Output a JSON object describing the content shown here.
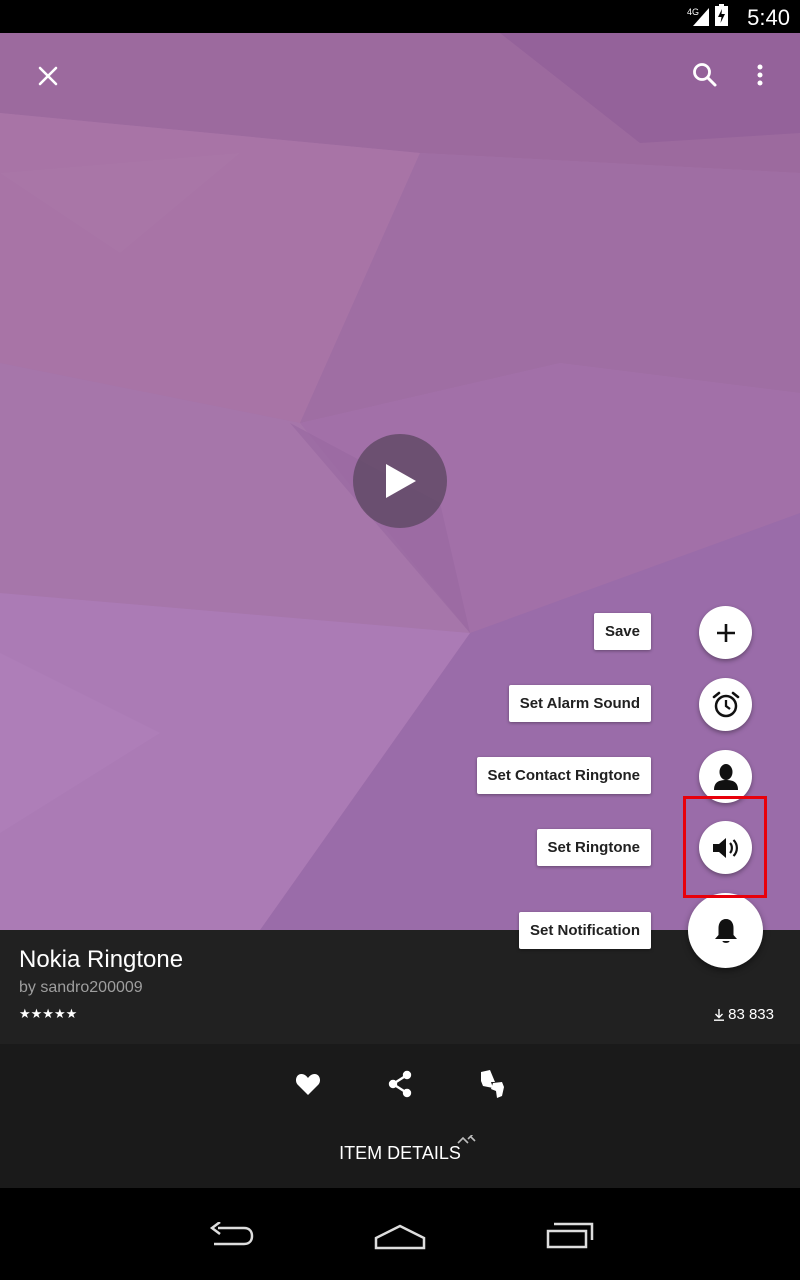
{
  "status": {
    "time": "5:40",
    "network": "4G"
  },
  "ringtone": {
    "title": "Nokia Ringtone",
    "author": "by sandro200009",
    "rating": "★★★★★",
    "rating_value": 5,
    "downloads": "83 833"
  },
  "fab_menu": {
    "items": [
      {
        "label": "Save",
        "icon": "plus-icon"
      },
      {
        "label": "Set Alarm Sound",
        "icon": "alarm-clock-icon"
      },
      {
        "label": "Set Contact Ringtone",
        "icon": "contact-person-icon"
      },
      {
        "label": "Set Ringtone",
        "icon": "speaker-icon"
      },
      {
        "label": "Set Notification",
        "icon": "bell-icon"
      }
    ]
  },
  "footer": {
    "item_details_label": "ITEM DETAILS"
  },
  "colors": {
    "hero": "#a070a8",
    "info_bg": "#212121",
    "actions_bg": "#1a1a1a",
    "highlight": "#e8000b"
  }
}
